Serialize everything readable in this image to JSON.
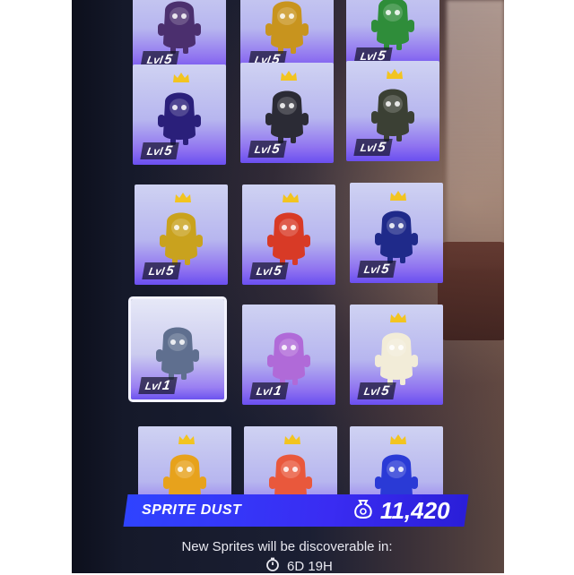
{
  "cards": [
    {
      "name": "sprite-card-r0-c0",
      "level_label": "Lvl",
      "level": "5",
      "color": "#4b2f6e",
      "selected": false,
      "crown": false
    },
    {
      "name": "sprite-card-r0-c1",
      "level_label": "Lvl",
      "level": "5",
      "color": "#c8941e",
      "selected": false,
      "crown": false
    },
    {
      "name": "sprite-card-r0-c2",
      "level_label": "Lvl",
      "level": "5",
      "color": "#2f8d3a",
      "selected": false,
      "crown": false
    },
    {
      "name": "sprite-card-r1-c0",
      "level_label": "Lvl",
      "level": "5",
      "color": "#2a1f7a",
      "selected": false,
      "crown": true
    },
    {
      "name": "sprite-card-r1-c1",
      "level_label": "Lvl",
      "level": "5",
      "color": "#2b2b35",
      "selected": false,
      "crown": true
    },
    {
      "name": "sprite-card-r1-c2",
      "level_label": "Lvl",
      "level": "5",
      "color": "#3b4034",
      "selected": false,
      "crown": true
    },
    {
      "name": "sprite-card-r2-c0",
      "level_label": "Lvl",
      "level": "5",
      "color": "#c9a21e",
      "selected": false,
      "crown": true
    },
    {
      "name": "sprite-card-r2-c1",
      "level_label": "Lvl",
      "level": "5",
      "color": "#d83a26",
      "selected": false,
      "crown": true
    },
    {
      "name": "sprite-card-r2-c2",
      "level_label": "Lvl",
      "level": "5",
      "color": "#1f2a8a",
      "selected": false,
      "crown": true
    },
    {
      "name": "sprite-card-r3-c0",
      "level_label": "Lvl",
      "level": "1",
      "color": "#5f6f8f",
      "selected": true,
      "crown": false
    },
    {
      "name": "sprite-card-r3-c1",
      "level_label": "Lvl",
      "level": "1",
      "color": "#b06ad8",
      "selected": false,
      "crown": false
    },
    {
      "name": "sprite-card-r3-c2",
      "level_label": "Lvl",
      "level": "5",
      "color": "#f2ecd8",
      "selected": false,
      "crown": true
    },
    {
      "name": "sprite-card-r4-c0",
      "level_label": "",
      "level": "",
      "color": "#e7a21c",
      "selected": false,
      "crown": true
    },
    {
      "name": "sprite-card-r4-c1",
      "level_label": "",
      "level": "",
      "color": "#e9583c",
      "selected": false,
      "crown": true
    },
    {
      "name": "sprite-card-r4-c2",
      "level_label": "",
      "level": "",
      "color": "#2a3ad6",
      "selected": false,
      "crown": true
    }
  ],
  "sprite_dust": {
    "label": "SPRITE DUST",
    "value": "11,420",
    "icon": "dust-pouch-icon"
  },
  "discovery": {
    "text": "New Sprites will be discoverable in:",
    "timer": "6D 19H",
    "icon": "stopwatch-icon"
  },
  "colors": {
    "accent": "#3a2cf2",
    "crown": "#f2c420"
  }
}
